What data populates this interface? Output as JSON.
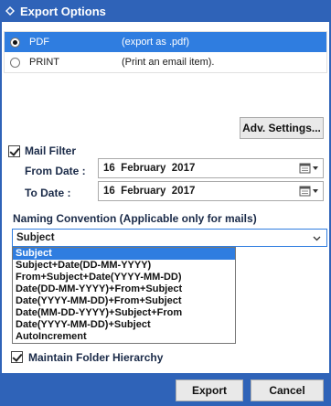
{
  "window": {
    "title": "Export Options"
  },
  "formats": [
    {
      "name": "PDF",
      "description": "(export as .pdf)",
      "selected": true
    },
    {
      "name": "PRINT",
      "description": "(Print an email item).",
      "selected": false
    }
  ],
  "adv_settings_label": "Adv. Settings...",
  "mail_filter": {
    "label": "Mail Filter",
    "checked": true,
    "from_label": "From Date :",
    "from_value": "16  February  2017",
    "to_label": "To Date :",
    "to_value": "16  February  2017"
  },
  "naming": {
    "label": "Naming Convention (Applicable only for mails)",
    "selected": "Subject",
    "options": [
      "Subject",
      "Subject+Date(DD-MM-YYYY)",
      "From+Subject+Date(YYYY-MM-DD)",
      "Date(DD-MM-YYYY)+From+Subject",
      "Date(YYYY-MM-DD)+From+Subject",
      "Date(MM-DD-YYYY)+Subject+From",
      "Date(YYYY-MM-DD)+Subject",
      "AutoIncrement"
    ]
  },
  "maintain_hierarchy": {
    "label": "Maintain Folder Hierarchy",
    "checked": true
  },
  "buttons": {
    "export": "Export",
    "cancel": "Cancel"
  },
  "colors": {
    "accent": "#2f63b8",
    "selection": "#2f7de0"
  }
}
